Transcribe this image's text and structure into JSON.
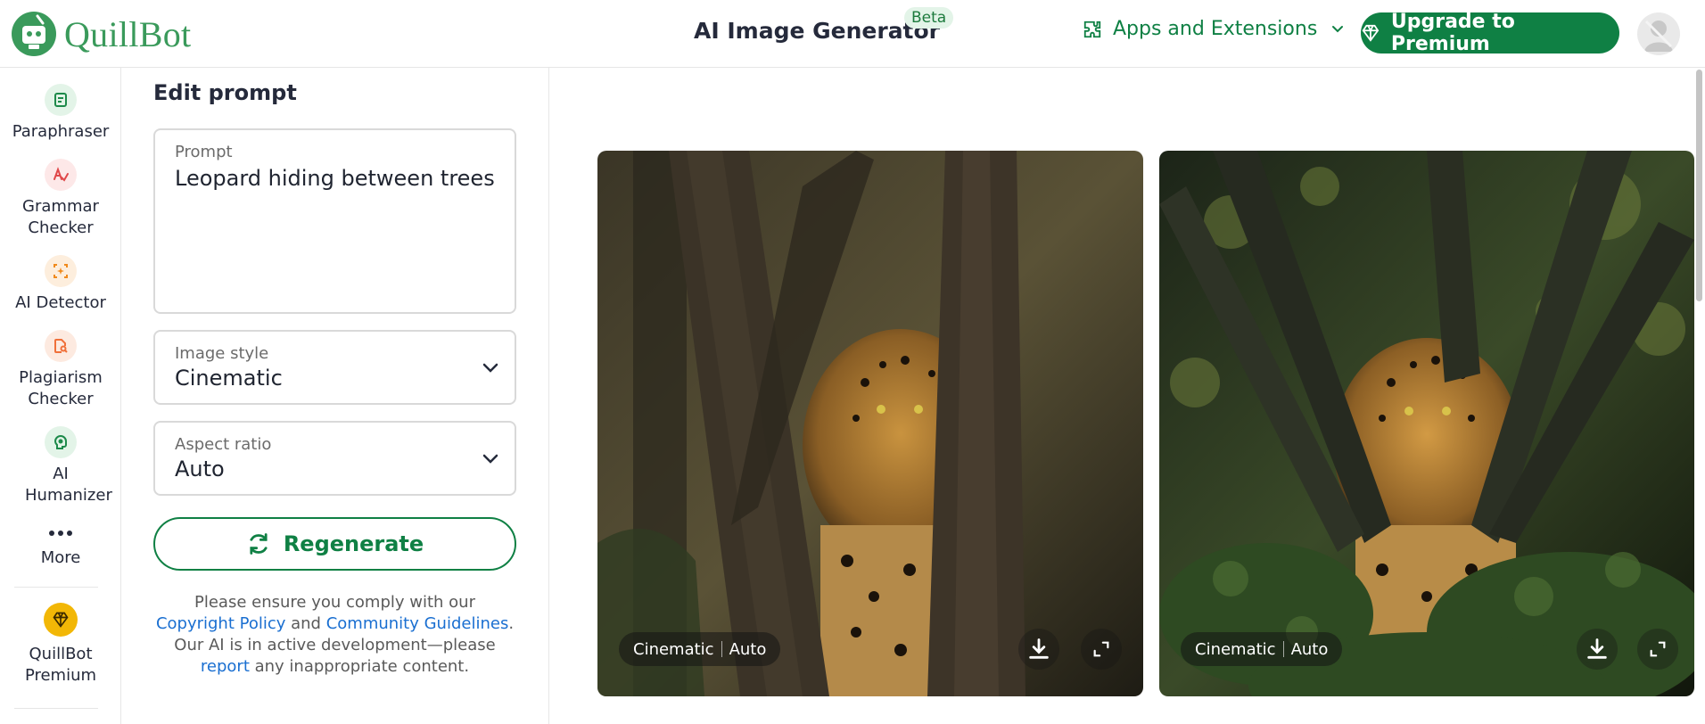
{
  "header": {
    "logo_text": "QuillBot",
    "title": "AI Image Generator",
    "beta_badge": "Beta",
    "apps_label": "Apps and Extensions",
    "upgrade_label": "Upgrade to Premium"
  },
  "sidebar": {
    "items": [
      {
        "label": "Paraphraser",
        "icon": "paraphraser-icon",
        "color": "#1d8a4a",
        "bg": "#e3f4e8"
      },
      {
        "label": "Grammar Checker",
        "icon": "grammar-checker-icon",
        "color": "#e0484a",
        "bg": "#fde8e8"
      },
      {
        "label": "AI Detector",
        "icon": "ai-detector-icon",
        "color": "#f08a1c",
        "bg": "#fdeedd"
      },
      {
        "label": "Plagiarism Checker",
        "icon": "plagiarism-checker-icon",
        "color": "#f0703a",
        "bg": "#fdeae0"
      },
      {
        "label": "AI Humanizer",
        "icon": "ai-humanizer-icon",
        "color": "#1d8a4a",
        "bg": "#e3f4e8"
      },
      {
        "label": "More",
        "icon": "more-dots-icon"
      },
      {
        "label": "QuillBot Premium",
        "icon": "premium-diamond-icon",
        "color": "#f2b706"
      }
    ]
  },
  "panel": {
    "title": "Edit prompt",
    "prompt_label": "Prompt",
    "prompt_value": "Leopard hiding between trees",
    "style_label": "Image style",
    "style_value": "Cinematic",
    "ratio_label": "Aspect ratio",
    "ratio_value": "Auto",
    "regenerate_label": "Regenerate",
    "notice": {
      "t1": "Please ensure you comply with our ",
      "link1": "Copyright Policy",
      "t2": " and ",
      "link2": "Community Guidelines",
      "t3": ". Our AI is in active development—please ",
      "link3": "report",
      "t4": " any inappropriate content."
    }
  },
  "images": [
    {
      "style_tag": "Cinematic",
      "ratio_tag": "Auto"
    },
    {
      "style_tag": "Cinematic",
      "ratio_tag": "Auto"
    }
  ],
  "colors": {
    "brand_green": "#0f8044",
    "link_blue": "#1a6fd1"
  }
}
